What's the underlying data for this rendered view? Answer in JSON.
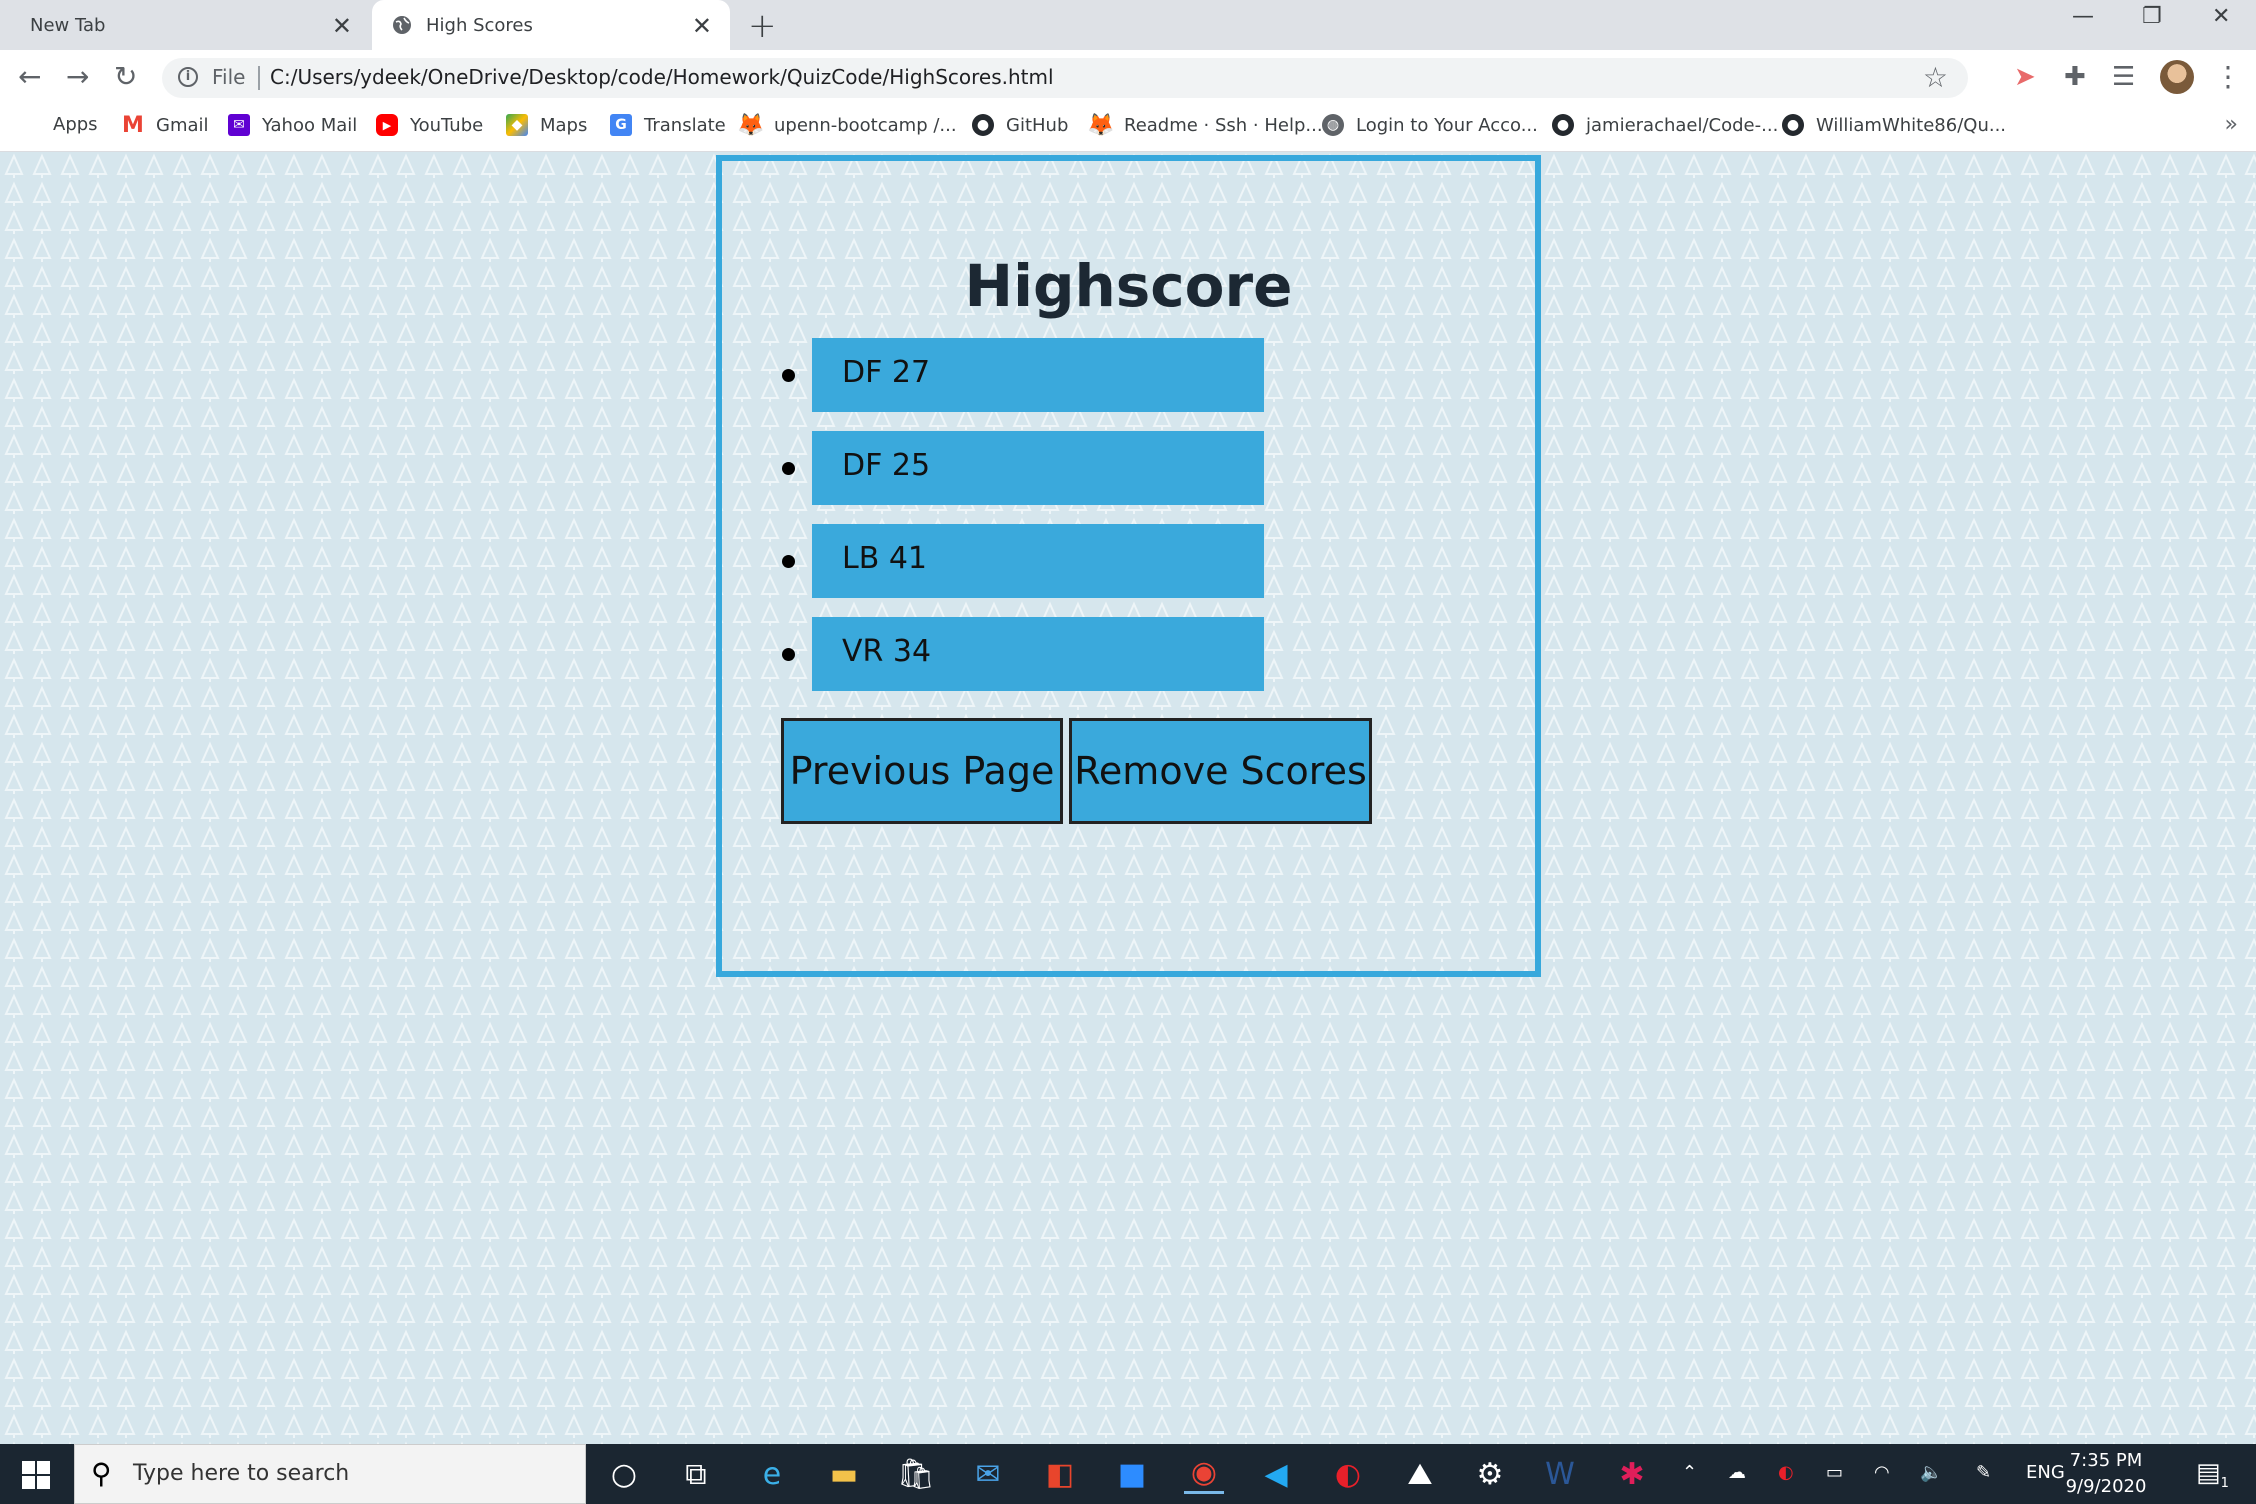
{
  "browser": {
    "tabs": [
      {
        "title": "New Tab",
        "active": false
      },
      {
        "title": "High Scores",
        "active": true
      }
    ],
    "address": {
      "scheme_label": "File",
      "url": "C:/Users/ydeek/OneDrive/Desktop/code/Homework/QuizCode/HighScores.html"
    },
    "bookmarks": [
      {
        "label": "Apps",
        "icon": "apps-grid-icon"
      },
      {
        "label": "Gmail",
        "icon": "gmail-icon"
      },
      {
        "label": "Yahoo Mail",
        "icon": "yahoo-mail-icon"
      },
      {
        "label": "YouTube",
        "icon": "youtube-icon"
      },
      {
        "label": "Maps",
        "icon": "maps-icon"
      },
      {
        "label": "Translate",
        "icon": "translate-icon"
      },
      {
        "label": "upenn-bootcamp /...",
        "icon": "gitlab-icon"
      },
      {
        "label": "GitHub",
        "icon": "github-icon"
      },
      {
        "label": "Readme · Ssh · Help...",
        "icon": "gitlab-icon"
      },
      {
        "label": "Login to Your Acco...",
        "icon": "globe-icon"
      },
      {
        "label": "jamierachael/Code-...",
        "icon": "github-icon"
      },
      {
        "label": "WilliamWhite86/Qu...",
        "icon": "github-icon"
      }
    ]
  },
  "page": {
    "title": "Highscore",
    "scores": [
      {
        "label": "DF 27"
      },
      {
        "label": "DF 25"
      },
      {
        "label": "LB 41"
      },
      {
        "label": "VR 34"
      }
    ],
    "buttons": {
      "previous": "Previous Page",
      "remove": "Remove Scores"
    },
    "colors": {
      "accent": "#3aa9dc",
      "border": "#37a8dc",
      "background": "#d6e6ed"
    }
  },
  "taskbar": {
    "search_placeholder": "Type here to search",
    "language": "ENG",
    "time": "7:35 PM",
    "date": "9/9/2020",
    "notification_count": "1"
  }
}
